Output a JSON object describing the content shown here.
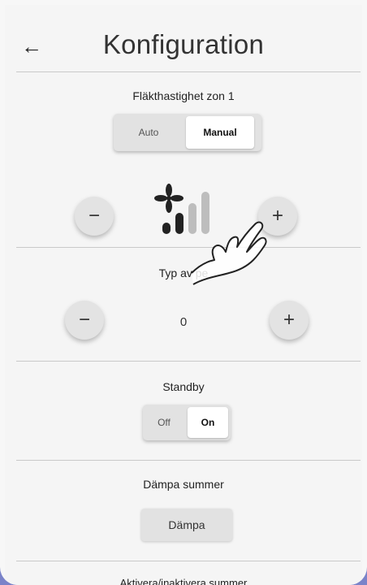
{
  "header": {
    "title": "Konfiguration",
    "back_icon": "arrow-left-icon"
  },
  "fan_speed": {
    "label": "Fläkthastighet zon 1",
    "modes": [
      "Auto",
      "Manual"
    ],
    "selected_mode": "Manual",
    "minus_label": "−",
    "plus_label": "+",
    "level": 2,
    "max_level": 4
  },
  "typ": {
    "label": "Typ av pe",
    "value": "0",
    "minus_label": "−",
    "plus_label": "+"
  },
  "standby": {
    "label": "Standby",
    "options": [
      "Off",
      "On"
    ],
    "selected": "On"
  },
  "mute": {
    "label": "Dämpa summer",
    "button_label": "Dämpa"
  },
  "buzzer": {
    "label": "Aktivera/inaktivera summer"
  },
  "colors": {
    "frame": "#7a83c9",
    "background": "#f5f5f5",
    "button": "#e3e3e3"
  }
}
